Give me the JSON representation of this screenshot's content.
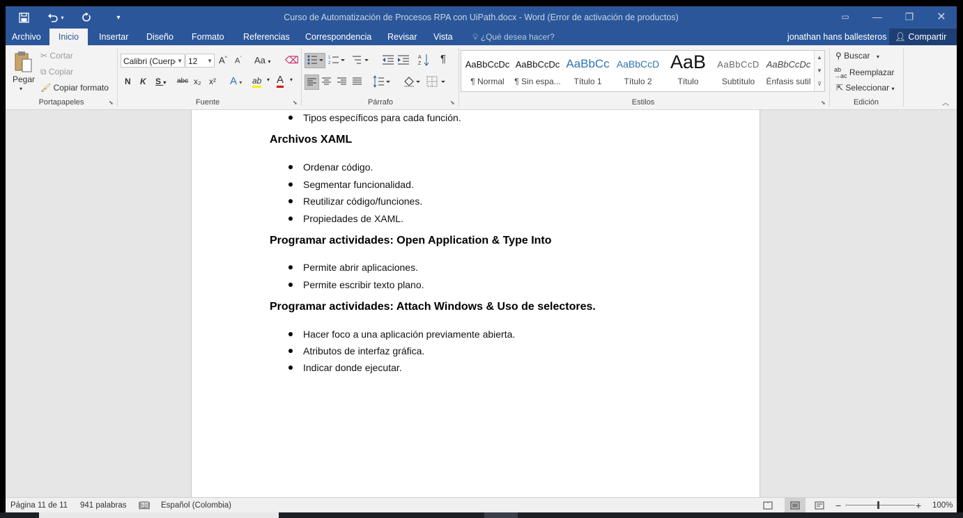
{
  "window": {
    "title": "Curso de Automatización de Procesos RPA con UiPath.docx - Word (Error de activación de productos)",
    "quick_access": {
      "save_icon": "save-icon",
      "undo_icon": "undo-icon",
      "redo_icon": "redo-icon",
      "customize_icon": "customize-qat-icon"
    },
    "controls": {
      "ribbon_display": "▭",
      "minimize": "—",
      "restore": "❐",
      "close": "✕"
    }
  },
  "tabs": [
    "Archivo",
    "Inicio",
    "Insertar",
    "Diseño",
    "Formato",
    "Referencias",
    "Correspondencia",
    "Revisar",
    "Vista"
  ],
  "active_tab": "Inicio",
  "tell_me": "¿Qué desea hacer?",
  "user_name": "jonathan hans ballesteros",
  "share_label": "Compartir",
  "ribbon": {
    "clipboard": {
      "label": "Portapapeles",
      "paste": "Pegar",
      "cut": "Cortar",
      "copy": "Copiar",
      "format_painter": "Copiar formato"
    },
    "font": {
      "label": "Fuente",
      "font_name": "Calibri (Cuerpo)",
      "font_size": "12",
      "grow": "A",
      "shrink": "A",
      "case": "Aa",
      "bold": "N",
      "italic": "K",
      "underline": "S",
      "strike": "abc",
      "subscript": "x₂",
      "superscript": "x²",
      "text_effects": "A",
      "highlight": "ab",
      "font_color": "A"
    },
    "paragraph": {
      "label": "Párrafo",
      "pilcrow": "¶"
    },
    "styles": {
      "label": "Estilos",
      "items": [
        {
          "sample": "AaBbCcDc",
          "name": "¶ Normal"
        },
        {
          "sample": "AaBbCcDc",
          "name": "¶ Sin espa..."
        },
        {
          "sample": "AaBbCc",
          "name": "Título 1"
        },
        {
          "sample": "AaBbCcD",
          "name": "Título 2"
        },
        {
          "sample": "AaB",
          "name": "Título"
        },
        {
          "sample": "AaBbCcD",
          "name": "Subtítulo"
        },
        {
          "sample": "AaBbCcDc",
          "name": "Énfasis sutil"
        }
      ]
    },
    "editing": {
      "label": "Edición",
      "find": "Buscar",
      "replace": "Reemplazar",
      "select": "Seleccionar"
    }
  },
  "document": {
    "blocks": [
      {
        "type": "bullet",
        "text": "Tipos específicos para cada función."
      },
      {
        "type": "heading",
        "text": "Archivos XAML"
      },
      {
        "type": "bullet",
        "text": "Ordenar código."
      },
      {
        "type": "bullet",
        "text": "Segmentar funcionalidad."
      },
      {
        "type": "bullet",
        "text": "Reutilizar código/funciones."
      },
      {
        "type": "bullet",
        "text": "Propiedades de XAML."
      },
      {
        "type": "heading",
        "text": "Programar actividades: Open Application & Type Into"
      },
      {
        "type": "bullet",
        "text": "Permite abrir aplicaciones."
      },
      {
        "type": "bullet",
        "text": "Permite escribir texto plano."
      },
      {
        "type": "heading",
        "text": "Programar actividades: Attach Windows & Uso de selectores."
      },
      {
        "type": "bullet",
        "text": "Hacer foco a una aplicación previamente abierta."
      },
      {
        "type": "bullet",
        "text": "Atributos de interfaz gráfica."
      },
      {
        "type": "bullet",
        "text": "Indicar donde ejecutar."
      }
    ]
  },
  "status_bar": {
    "page": "Página 11 de 11",
    "words": "941 palabras",
    "language": "Español (Colombia)",
    "zoom": "100%"
  }
}
